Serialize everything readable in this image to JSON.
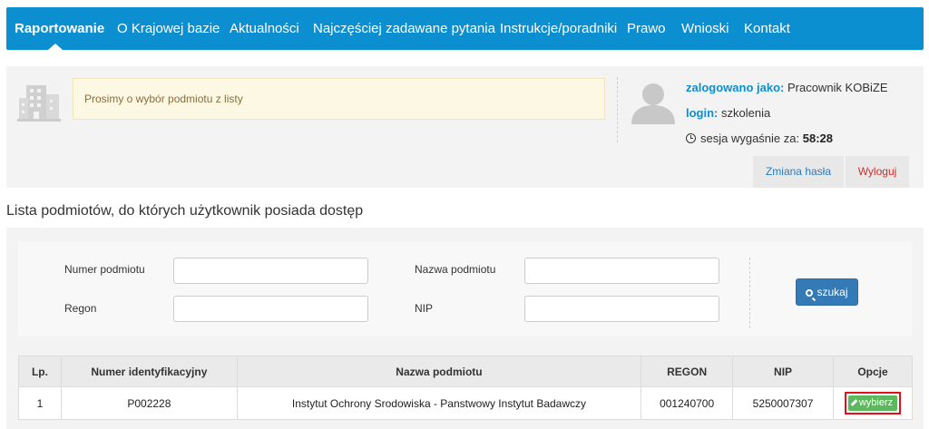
{
  "nav": {
    "items": [
      {
        "label": "Raportowanie"
      },
      {
        "label": "O Krajowej bazie"
      },
      {
        "label": "Aktualności"
      },
      {
        "label": "Najczęściej zadawane pytania"
      },
      {
        "label": "Instrukcje/poradniki"
      },
      {
        "label": "Prawo"
      },
      {
        "label": "Wnioski"
      },
      {
        "label": "Kontakt"
      }
    ],
    "active": "Raportowanie",
    "color": "#0b8fd1"
  },
  "alert": {
    "text": "Prosimy o wybór podmiotu z listy"
  },
  "user": {
    "logged_label": "zalogowano jako:",
    "logged_value": "Pracownik KOBiZE",
    "login_label": "login:",
    "login_value": "szkolenia",
    "session_label": "sesja wygaśnie za:",
    "session_value": "58:28",
    "change_password": "Zmiana hasła",
    "logout": "Wyloguj"
  },
  "list": {
    "title": "Lista podmiotów, do których użytkownik posiada dostęp"
  },
  "search": {
    "numer_label": "Numer podmiotu",
    "numer_value": "",
    "nazwa_label": "Nazwa podmiotu",
    "nazwa_value": "",
    "regon_label": "Regon",
    "regon_value": "",
    "nip_label": "NIP",
    "nip_value": "",
    "button": "szukaj"
  },
  "table": {
    "headers": [
      "Lp.",
      "Numer identyfikacyjny",
      "Nazwa podmiotu",
      "REGON",
      "NIP",
      "Opcje"
    ],
    "rows": [
      {
        "lp": "1",
        "numer": "P002228",
        "nazwa": "Instytut Ochrony Srodowiska - Panstwowy Instytut Badawczy",
        "regon": "001240700",
        "nip": "5250007307",
        "action": "wybierz"
      }
    ]
  }
}
